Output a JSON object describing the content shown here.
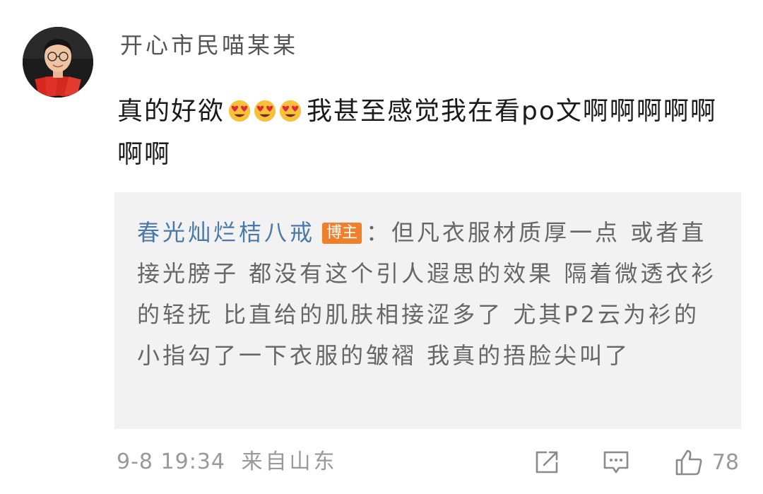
{
  "comment": {
    "username": "开心市民喵某某",
    "text_part1": "真的好欲",
    "emoji_count": 3,
    "emoji_name": "heart-eyes-emoji",
    "text_part2": "我甚至感觉我在看po文啊啊啊啊啊啊啊"
  },
  "quote": {
    "author": "春光灿烂桔八戒",
    "badge": "博主",
    "separator": "：",
    "text": "但凡衣服材质厚一点 或者直接光膀子 都没有这个引人遐思的效果 隔着微透衣衫的轻抚 比直给的肌肤相接涩多了 尤其P2云为衫的小指勾了一下衣服的皱褶 我真的捂脸尖叫了"
  },
  "footer": {
    "date_time": "9-8  19:34",
    "source": "来自山东",
    "like_count": "78"
  },
  "colors": {
    "author_link": "#4a78a8",
    "badge_bg": "#ef7f2a",
    "quote_bg": "#f2f2f2",
    "meta_text": "#999999"
  }
}
